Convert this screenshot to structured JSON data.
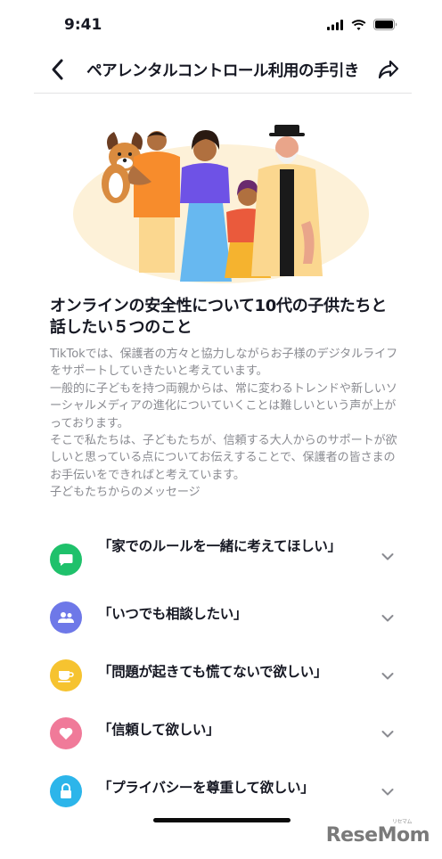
{
  "status_bar": {
    "time": "9:41"
  },
  "nav": {
    "title": "ペアレンタルコントロール利用の手引き"
  },
  "content": {
    "heading": "オンラインの安全性について10代の子供たちと話したい５つのこと",
    "paragraphs": [
      "TikTokでは、保護者の方々と協力しながらお子様のデジタルライフをサポートしていきたいと考えています。",
      "一般的に子どもを持つ両親からは、常に変わるトレンドや新しいソーシャルメディアの進化についていくことは難しいという声が上がっております。",
      "そこで私たちは、子どもたちが、信頼する大人からのサポートが欲しいと思っている点についてお伝えすることで、保護者の皆さまのお手伝いをできればと考えています。",
      "子どもたちからのメッセージ"
    ]
  },
  "messages": [
    {
      "label": "「家でのルールを一緒に考えてほしい」",
      "icon": "chat-bubble-icon",
      "color": "#1fc16b"
    },
    {
      "label": "「いつでも相談したい」",
      "icon": "people-icon",
      "color": "#6e78e8"
    },
    {
      "label": "「問題が起きても慌てないで欲しい」",
      "icon": "coffee-cup-icon",
      "color": "#f6c330"
    },
    {
      "label": "「信頼して欲しい」",
      "icon": "heart-icon",
      "color": "#f07a99"
    },
    {
      "label": "「プライバシーを尊重して欲しい」",
      "icon": "lock-icon",
      "color": "#2cb5ea"
    }
  ],
  "watermark": {
    "text": "ReseMom",
    "kana": "リセマム"
  }
}
